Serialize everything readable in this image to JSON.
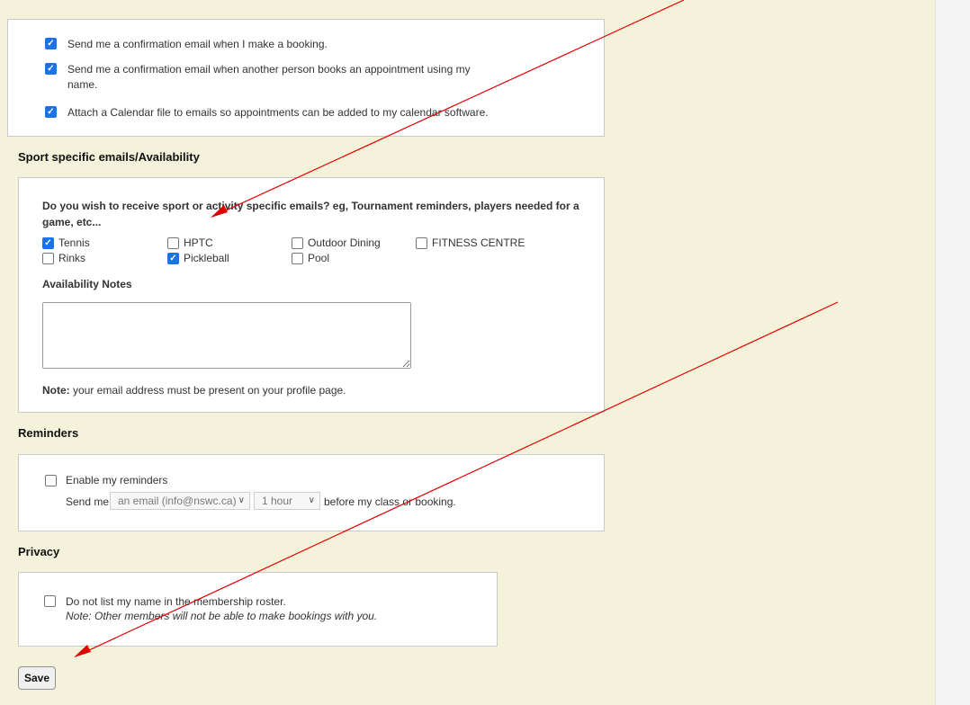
{
  "email_prefs": {
    "items": [
      {
        "label": "Send me a confirmation email when I make a booking.",
        "checked": true
      },
      {
        "label": "Send me a confirmation email when another person books an appointment using my",
        "label2": "name.",
        "checked": true
      },
      {
        "label": "Attach a Calendar file to emails so appointments can be added to my calendar software.",
        "checked": true
      }
    ]
  },
  "sport": {
    "title": "Sport specific emails/Availability",
    "question_line1": "Do you wish to receive sport or activity specific emails? eg, Tournament reminders, players needed for a",
    "question_line2": "game, etc...",
    "options": [
      {
        "label": "Tennis",
        "checked": true
      },
      {
        "label": "HPTC",
        "checked": false
      },
      {
        "label": "Outdoor Dining",
        "checked": false
      },
      {
        "label": "FITNESS CENTRE",
        "checked": false
      },
      {
        "label": "Rinks",
        "checked": false
      },
      {
        "label": "Pickleball",
        "checked": true
      },
      {
        "label": "Pool",
        "checked": false
      }
    ],
    "availability_label": "Availability Notes",
    "availability_value": "",
    "note_bold": "Note:",
    "note_text": " your email address must be present on your profile page."
  },
  "reminders": {
    "title": "Reminders",
    "enable_label": "Enable my reminders",
    "enable_checked": false,
    "send_me": "Send me",
    "method_value": "an email (info@nswc.ca)",
    "time_value": "1 hour",
    "suffix": "before my class or booking."
  },
  "privacy": {
    "title": "Privacy",
    "label": "Do not list my name in the membership roster.",
    "checked": false,
    "note": "Note: Other members will not be able to make bookings with you."
  },
  "save_label": "Save",
  "colors": {
    "background": "#f4f2da",
    "panel": "#ffffff",
    "checkbox_checked": "#1a73e8",
    "annotation_arrow": "#e00000"
  }
}
